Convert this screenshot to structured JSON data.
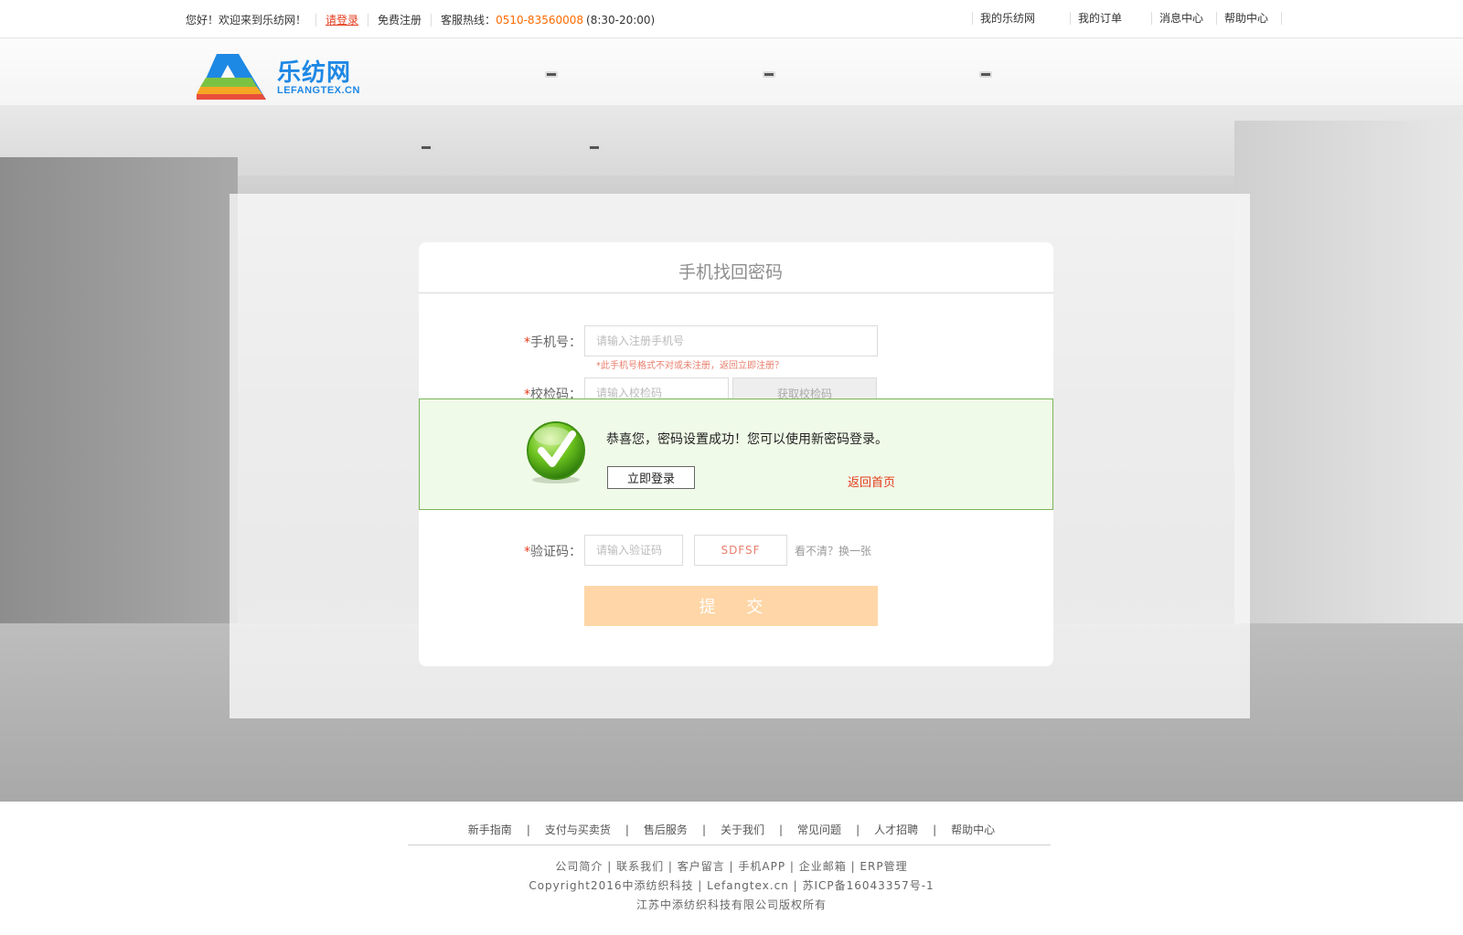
{
  "topbar": {
    "welcome": "您好！欢迎来到乐纺网！",
    "login": "请登录",
    "register": "免费注册",
    "hotline_label": "客服热线：",
    "hotline_number": "0510-83560008",
    "hotline_hours": "(8:30-20:00)",
    "right_links": [
      "我的乐纺网",
      "我的订单",
      "消息中心",
      "帮助中心"
    ]
  },
  "brand": {
    "name": "乐纺网",
    "domain": "LEFANGTEX.CN",
    "colors": [
      "#1e88e5",
      "#7cc242",
      "#f5a623",
      "#e94e3c"
    ]
  },
  "form": {
    "title": "手机找回密码",
    "phone_label": "手机号：",
    "phone_placeholder": "请输入注册手机号",
    "phone_error": "*此手机号格式不对或未注册，返回立即注册？",
    "code_label": "校检码：",
    "code_placeholder": "请输入校检码",
    "get_code": "获取校检码",
    "captcha_label": "验证码：",
    "captcha_placeholder": "请输入验证码",
    "captcha_text": "SDFSF",
    "captcha_refresh": "看不清？换一张",
    "required_mark": "*",
    "submit": "提 交"
  },
  "dialog": {
    "message": "恭喜您，密码设置成功！您可以使用新密码登录。",
    "login_button": "立即登录",
    "home_link": "返回首页",
    "icon": "check-icon"
  },
  "footer": {
    "nav": [
      "新手指南",
      "支付与买卖货",
      "售后服务",
      "关于我们",
      "常见问题",
      "人才招聘",
      "帮助中心"
    ],
    "links_line": "公司简介 | 联系我们 | 客户留言 | 手机APP | 企业邮箱 | ERP管理",
    "copyright": "Copyright2016中添纺织科技 | Lefangtex.cn | 苏ICP备16043357号-1",
    "company": "江苏中添纺织科技有限公司版权所有"
  }
}
